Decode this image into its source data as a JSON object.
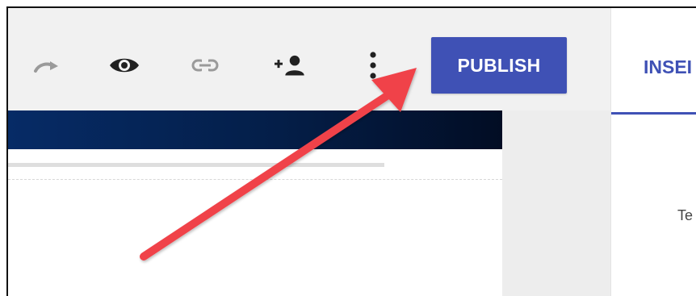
{
  "toolbar": {
    "icons": [
      "redo-icon",
      "preview-eye-icon",
      "link-icon",
      "share-add-person-icon",
      "more-vert-icon"
    ],
    "publish_label": "PUBLISH",
    "accent_color": "#3f51b5"
  },
  "side_panel": {
    "tab_label": "INSEI",
    "partial_text": "Te"
  },
  "annotation": {
    "arrow_color": "#f0424a",
    "points_to": "publish-button"
  }
}
